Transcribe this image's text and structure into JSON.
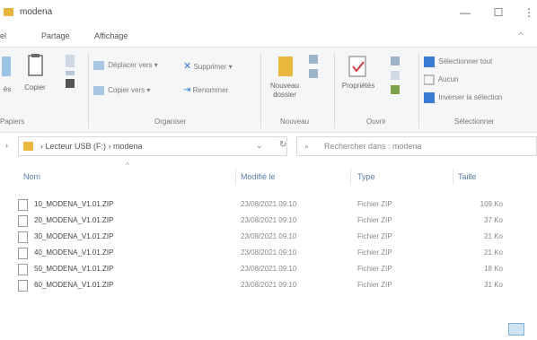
{
  "window": {
    "title": "modena",
    "minimize_label": "—",
    "maximize_label": "☐",
    "close_label": "⋮"
  },
  "tabs": {
    "file_label": "el",
    "share_label": "Partage",
    "view_label": "Affichage",
    "expand_label": "^"
  },
  "ribbon": {
    "clipboard": {
      "pin_label": "ès",
      "copy_label": "Copier",
      "paste_label": "Coller",
      "group_label": "Papiers"
    },
    "organize": {
      "move_to_label": "Déplacer vers ▾",
      "copy_to_label": "Copier vers ▾",
      "delete_label": "Supprimer ▾",
      "rename_label": "Renommer",
      "group_label": "Organiser"
    },
    "new": {
      "new_folder_label": "Nouveau dossier",
      "group_label": "Nouveau"
    },
    "open": {
      "properties_label": "Propriétés",
      "group_label": "Ouvrir"
    },
    "select": {
      "select_all_label": "Sélectionner tout",
      "select_none_label": "Aucun",
      "invert_label": "Inverser la sélection",
      "group_label": "Sélectionner"
    }
  },
  "address": {
    "path": "›  Lecteur USB (F:)  ›  modena",
    "search_placeholder": "Rechercher dans : modena"
  },
  "columns": {
    "name": "Nom",
    "modified": "Modifié le",
    "type": "Type",
    "size": "Taille"
  },
  "files": [
    {
      "name": "10_MODENA_V1.01.ZIP",
      "date": "23/08/2021 09:10",
      "type": "Fichier ZIP",
      "size": "109 Ko"
    },
    {
      "name": "20_MODENA_V1.01.ZIP",
      "date": "23/08/2021 09:10",
      "type": "Fichier ZIP",
      "size": "37 Ko"
    },
    {
      "name": "30_MODENA_V1.01.ZIP",
      "date": "23/08/2021 09:10",
      "type": "Fichier ZIP",
      "size": "21 Ko"
    },
    {
      "name": "40_MODENA_V1.01.ZIP",
      "date": "23/08/2021 09:10",
      "type": "Fichier ZIP",
      "size": "21 Ko"
    },
    {
      "name": "50_MODENA_V1.01.ZIP",
      "date": "23/08/2021 09:10",
      "type": "Fichier ZIP",
      "size": "18 Ko"
    },
    {
      "name": "60_MODENA_V1.01.ZIP",
      "date": "23/08/2021 09:10",
      "type": "Fichier ZIP",
      "size": "31 Ko"
    }
  ],
  "colors": {
    "folder": "#eab83f",
    "accent": "#5b7fa8"
  },
  "icons": [
    "folder-icon",
    "clipboard-icon",
    "scissors-icon",
    "delete-icon",
    "rename-icon",
    "properties-icon",
    "select-all-icon",
    "search-icon",
    "refresh-icon",
    "zip-file-icon"
  ]
}
